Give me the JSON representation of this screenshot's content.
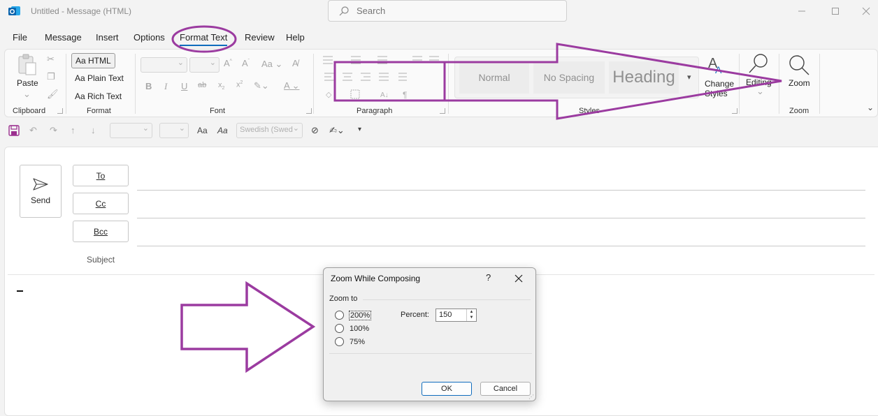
{
  "titlebar": {
    "title": "Untitled  -  Message (HTML)",
    "search_placeholder": "Search"
  },
  "menu": {
    "tabs": [
      "File",
      "Message",
      "Insert",
      "Options",
      "Format Text",
      "Review",
      "Help"
    ],
    "active": "Format Text"
  },
  "ribbon": {
    "clipboard": {
      "label": "Clipboard",
      "paste": "Paste"
    },
    "format": {
      "label": "Format",
      "html": "Aa HTML",
      "plain": "Aa Plain Text",
      "rich": "Aa Rich Text"
    },
    "font": {
      "label": "Font",
      "aa_label": "Aa"
    },
    "paragraph": {
      "label": "Paragraph"
    },
    "styles": {
      "label": "Styles",
      "normal": "Normal",
      "no_spacing": "No Spacing",
      "heading": "Heading",
      "change_styles_1": "Change",
      "change_styles_2": "Styles"
    },
    "editing": {
      "label": "Editing"
    },
    "zoom": {
      "label": "Zoom",
      "button": "Zoom"
    }
  },
  "qat": {
    "aa1": "Aa",
    "aa2": "Aa",
    "language": "Swedish (Swed"
  },
  "compose": {
    "send": "Send",
    "to": "To",
    "cc": "Cc",
    "bcc": "Bcc",
    "subject": "Subject"
  },
  "dialog": {
    "title": "Zoom While Composing",
    "help": "?",
    "zoom_to": "Zoom to",
    "options": [
      "200%",
      "100%",
      "75%"
    ],
    "percent_label": "Percent:",
    "percent_value": "150",
    "ok": "OK",
    "cancel": "Cancel"
  },
  "colors": {
    "annotation": "#9b3ba0",
    "accent": "#0f6cbd"
  }
}
